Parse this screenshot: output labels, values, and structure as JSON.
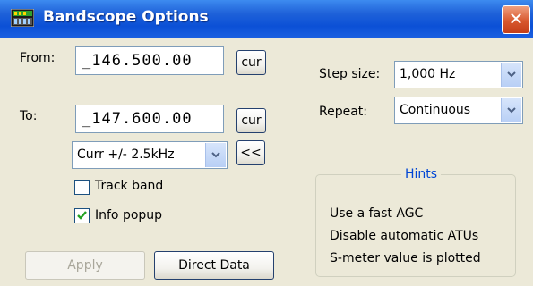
{
  "window": {
    "title": "Bandscope Options",
    "close_glyph": "✕"
  },
  "frequency": {
    "from_label": "From:",
    "from_value": "_146.500.00",
    "to_label": "To:",
    "to_value": "_147.600.00",
    "cur_button_label": "cur",
    "span_selected": "Curr +/- 2.5kHz",
    "back_button_label": "<<"
  },
  "options": {
    "track_band_label": "Track band",
    "track_band_checked": false,
    "info_popup_label": "Info popup",
    "info_popup_checked": true
  },
  "buttons": {
    "apply_label": "Apply",
    "direct_data_label": "Direct Data"
  },
  "settings": {
    "step_size_label": "Step size:",
    "step_size_value": "1,000 Hz",
    "repeat_label": "Repeat:",
    "repeat_value": "Continuous"
  },
  "hints": {
    "title": "Hints",
    "items": [
      "Use a fast AGC",
      "Disable automatic ATUs",
      "S-meter value is plotted"
    ]
  },
  "colors": {
    "titlebar": "#0b50d6",
    "close": "#d8582e",
    "hints_title": "#0046d5",
    "dialog_bg": "#ece9d8"
  }
}
